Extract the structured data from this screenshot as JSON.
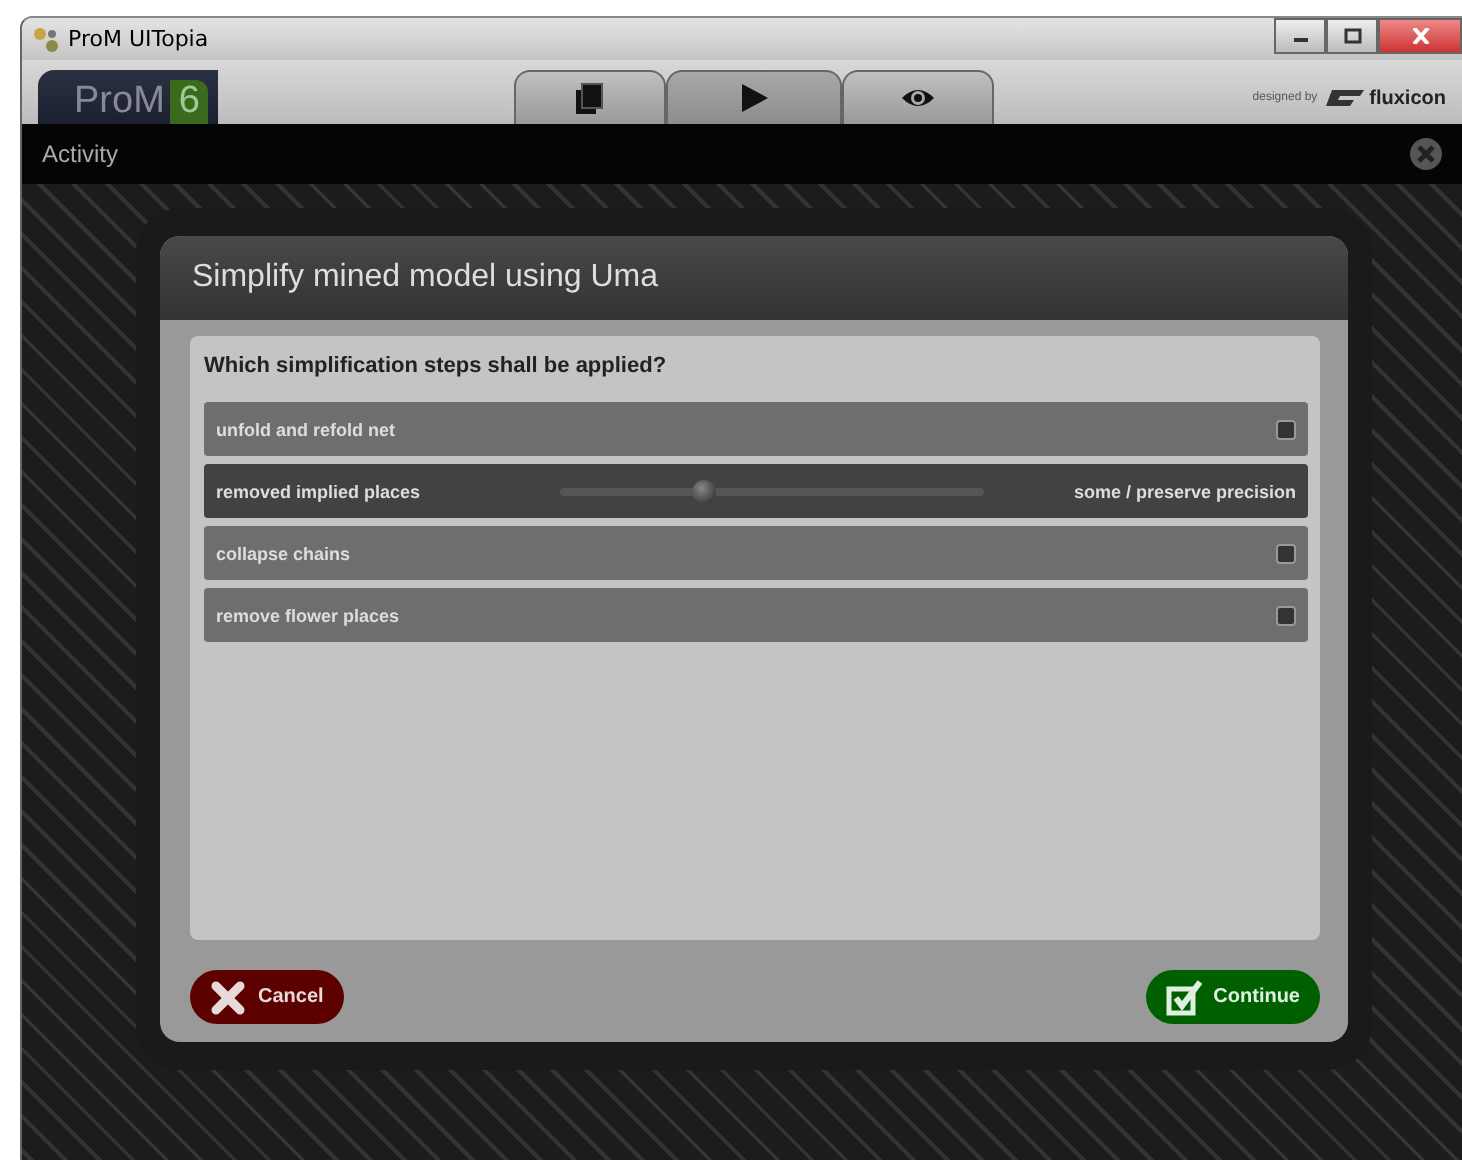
{
  "window": {
    "title": "ProM UITopia"
  },
  "logo": {
    "name": "ProM",
    "version": "6"
  },
  "tabs": [
    {
      "kind": "pages",
      "selected": false
    },
    {
      "kind": "play",
      "selected": true
    },
    {
      "kind": "view",
      "selected": false
    }
  ],
  "credit": {
    "prefix": "designed by",
    "brand": "fluxicon"
  },
  "activity_bar": {
    "title": "Activity"
  },
  "dialog": {
    "title": "Simplify mined model using Uma",
    "question": "Which simplification steps shall be applied?",
    "options": [
      {
        "kind": "checkbox",
        "label": "unfold and refold net",
        "checked": false
      },
      {
        "kind": "slider",
        "label": "removed implied places",
        "level": 0.34,
        "reading": "some / preserve precision"
      },
      {
        "kind": "checkbox",
        "label": "collapse chains",
        "checked": false
      },
      {
        "kind": "checkbox",
        "label": "remove flower places",
        "checked": false
      }
    ],
    "cancel": "Cancel",
    "continue": "Continue"
  }
}
